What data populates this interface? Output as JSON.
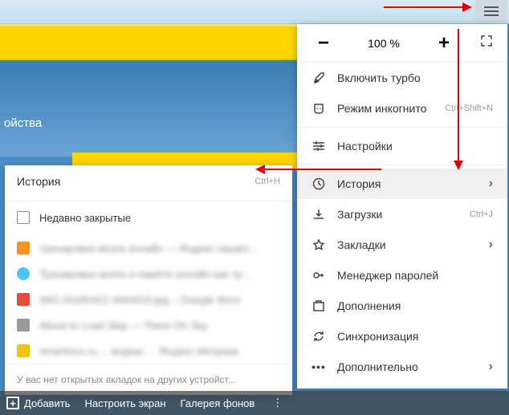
{
  "background": {
    "settings_tab": "ойства"
  },
  "hamburger": {
    "name": "menu"
  },
  "main_menu": {
    "zoom": {
      "minus": "−",
      "value": "100 %",
      "plus": "+"
    },
    "items": [
      {
        "icon": "rocket-icon",
        "label": "Включить турбо"
      },
      {
        "icon": "incognito-icon",
        "label": "Режим инкогнито",
        "shortcut": "Ctrl+Shift+N"
      }
    ],
    "settings": {
      "icon": "sliders-icon",
      "label": "Настройки"
    },
    "items2": [
      {
        "icon": "history-icon",
        "label": "История",
        "chevron": true,
        "highlighted": true
      },
      {
        "icon": "download-icon",
        "label": "Загрузки",
        "shortcut": "Ctrl+J"
      },
      {
        "icon": "star-icon",
        "label": "Закладки",
        "chevron": true
      },
      {
        "icon": "key-icon",
        "label": "Менеджер паролей"
      },
      {
        "icon": "extensions-icon",
        "label": "Дополнения"
      },
      {
        "icon": "sync-icon",
        "label": "Синхронизация"
      },
      {
        "icon": "more-icon",
        "label": "Дополнительно",
        "chevron": true
      }
    ]
  },
  "submenu": {
    "title": "История",
    "shortcut": "Ctrl+H",
    "recently_closed": "Недавно закрытые",
    "entries": [
      {
        "color": "orange",
        "text": "тренировка мозга онлайн — Яндекс нашел..."
      },
      {
        "color": "blue",
        "text": "Тренировка мозга и памяти онлайн как тр..."
      },
      {
        "color": "red",
        "text": "IMG-20180421-WA0015.jpg – Google Фото"
      },
      {
        "color": "gray",
        "text": "About to Load Skip — There On Sky"
      },
      {
        "color": "yellow",
        "text": "smarttrics.ru ... андекс ... Яндекс.Метрика"
      }
    ],
    "footer": "У вас нет открытых вкладок на других устройст..."
  },
  "bottom_bar": {
    "add": "Добавить",
    "configure": "Настроить экран",
    "gallery": "Галерея фонов"
  }
}
